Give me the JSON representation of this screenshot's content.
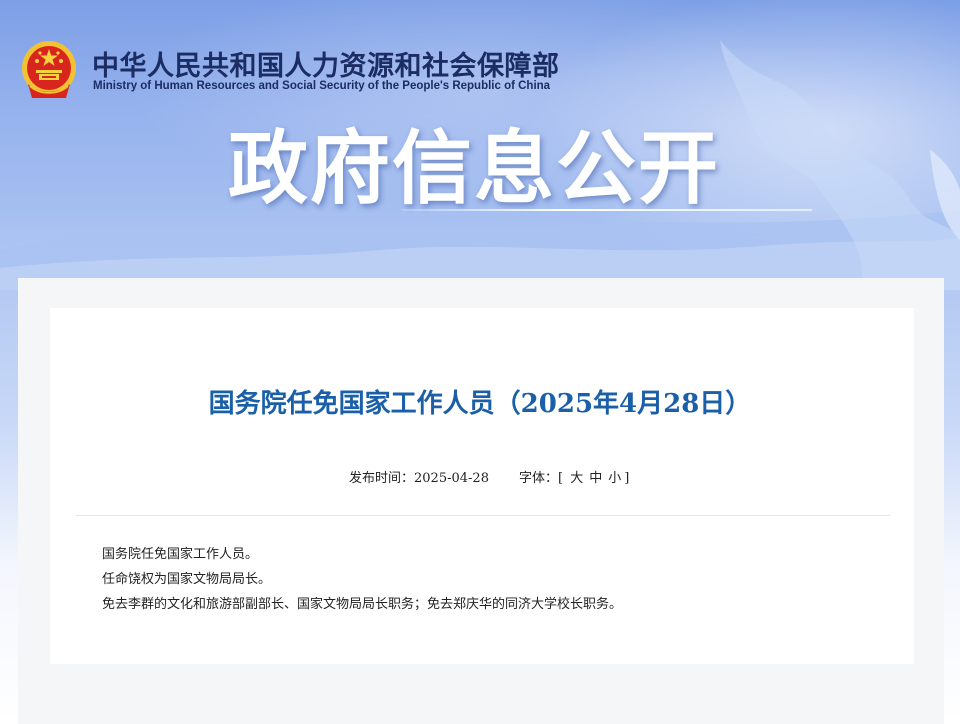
{
  "header": {
    "emblem_icon": "national-emblem-icon",
    "ministry_name_cn": "中华人民共和国人力资源和社会保障部",
    "ministry_name_en": "Ministry of Human Resources and Social Security of the People's Republic of China",
    "banner_title": "政府信息公开"
  },
  "article": {
    "title": "国务院任免国家工作人员（2025年4月28日）",
    "publish_label": "发布时间：",
    "publish_date": "2025-04-28",
    "font_size_label": "字体：",
    "font_size_open": "[",
    "font_size_large": "大",
    "font_size_medium": "中",
    "font_size_small": "小",
    "font_size_close": "]",
    "paragraphs": [
      "国务院任免国家工作人员。",
      "任命饶权为国家文物局局长。",
      "免去李群的文化和旅游部副部长、国家文物局局长职务；免去郑庆华的同济大学校长职务。"
    ]
  },
  "colors": {
    "title_blue": "#1a5fa8",
    "ministry_navy": "#1c2d63",
    "banner_blue": "#97b3ee"
  }
}
